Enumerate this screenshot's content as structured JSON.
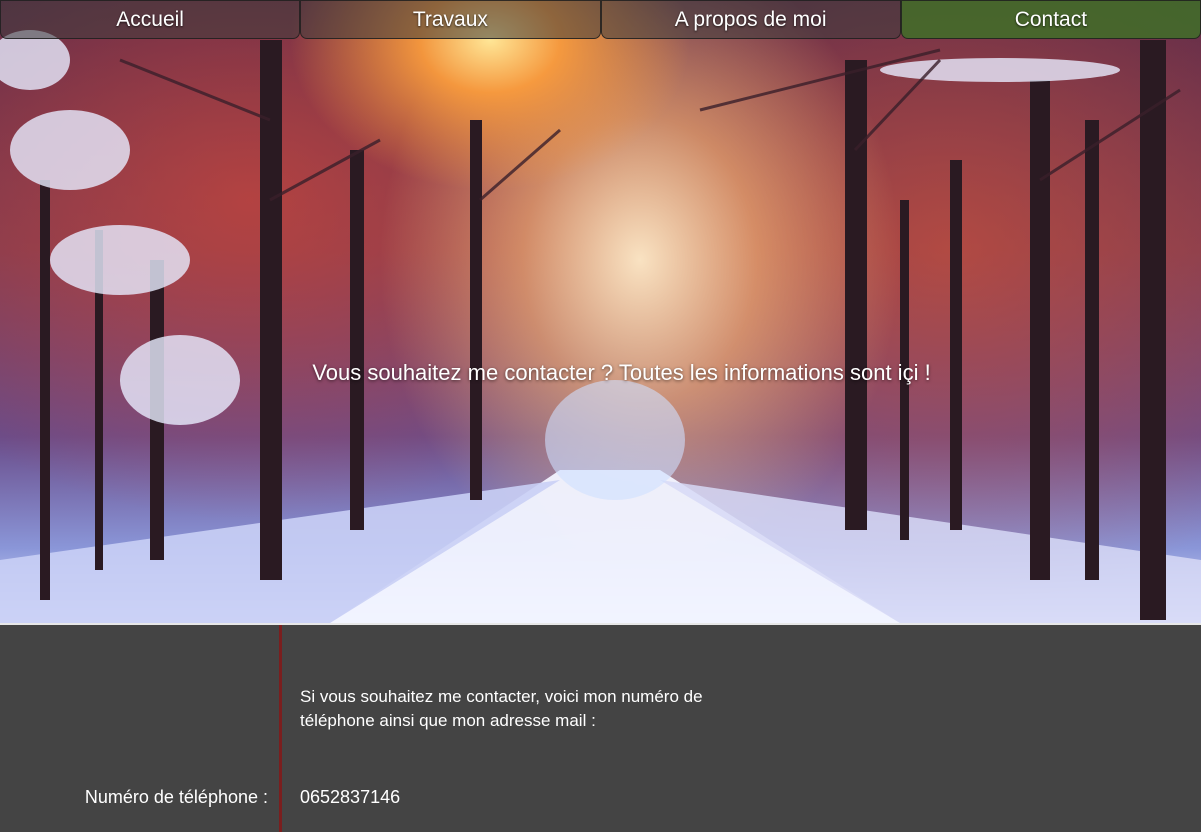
{
  "nav": {
    "items": [
      {
        "label": "Accueil"
      },
      {
        "label": "Travaux"
      },
      {
        "label": "A propos de moi"
      },
      {
        "label": "Contact"
      }
    ]
  },
  "hero": {
    "text": "Vous souhaitez me contacter ? Toutes les informations sont içi !"
  },
  "contact": {
    "intro_line1": "Si vous souhaitez me contacter, voici mon numéro de",
    "intro_line2": "téléphone ainsi que mon adresse mail :",
    "phone_label": "Numéro de téléphone :",
    "phone_value": "0652837146"
  },
  "colors": {
    "active_tab": "#406e28",
    "section_bg": "#444444",
    "divider": "#7a1e1e"
  }
}
